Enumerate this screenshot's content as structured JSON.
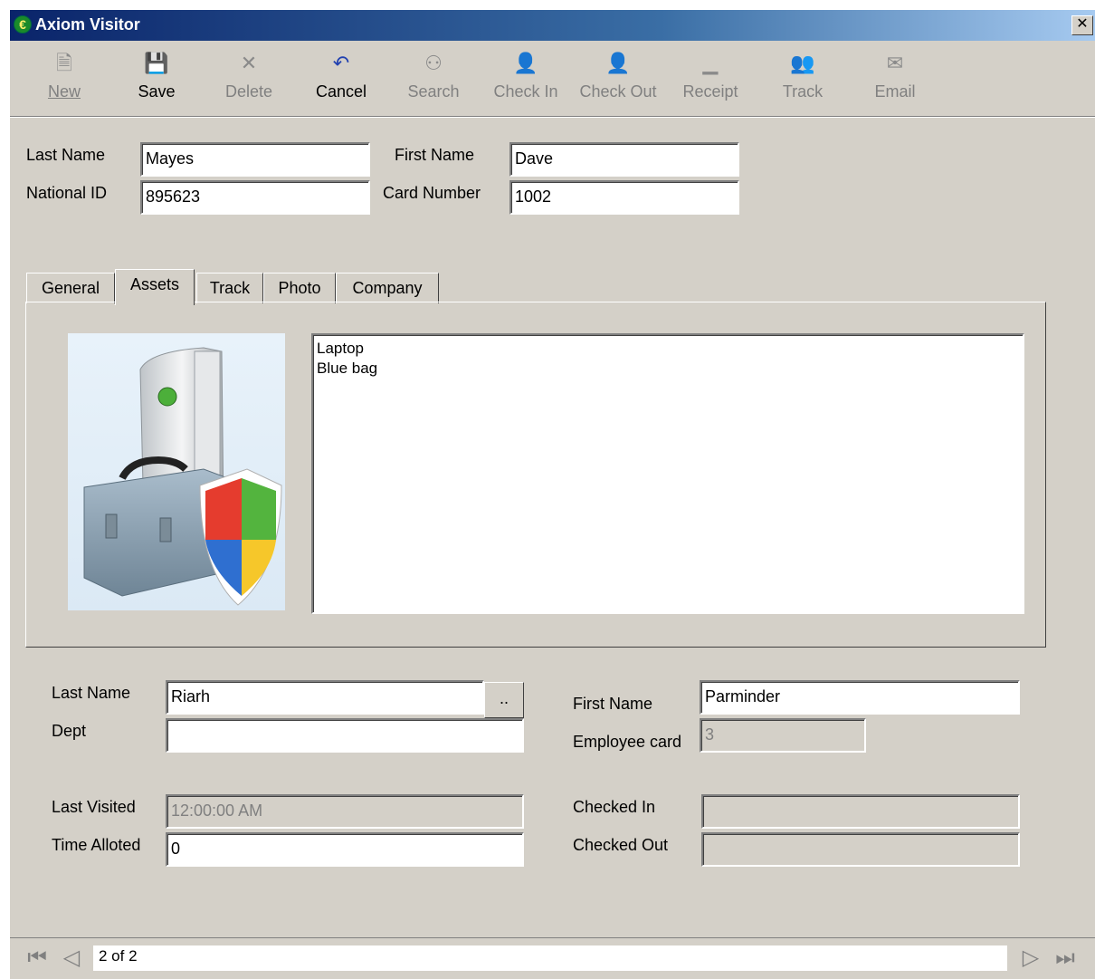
{
  "window": {
    "title": "Axiom Visitor",
    "close_glyph": "✕"
  },
  "toolbar": {
    "new": "New",
    "save": "Save",
    "delete": "Delete",
    "cancel": "Cancel",
    "search": "Search",
    "check_in": "Check In",
    "check_out": "Check Out",
    "receipt": "Receipt",
    "track": "Track",
    "email": "Email"
  },
  "visitor": {
    "last_name_label": "Last Name",
    "last_name": "Mayes",
    "first_name_label": "First Name",
    "first_name": "Dave",
    "national_id_label": "National ID",
    "national_id": "895623",
    "card_number_label": "Card Number",
    "card_number": "1002"
  },
  "tabs": [
    "General",
    "Assets",
    "Track",
    "Photo",
    "Company"
  ],
  "assets": {
    "lines": [
      "Laptop",
      "Blue bag"
    ]
  },
  "host": {
    "last_name_label": "Last Name",
    "last_name": "Riarh",
    "browse_label": "..",
    "first_name_label": "First Name",
    "first_name": "Parminder",
    "dept_label": "Dept",
    "dept": "",
    "employee_card_label": "Employee card",
    "employee_card": "3"
  },
  "visit": {
    "last_visited_label": "Last Visited",
    "last_visited": "12:00:00 AM",
    "time_alloted_label": "Time Alloted",
    "time_alloted": "0",
    "checked_in_label": "Checked In",
    "checked_in": "",
    "checked_out_label": "Checked Out",
    "checked_out": ""
  },
  "navigator": {
    "record": "2 of 2"
  },
  "icons": {
    "new": "new-document-icon",
    "save": "floppy-disk-icon",
    "delete": "x-delete-icon",
    "cancel": "undo-arrow-icon",
    "search": "binoculars-icon",
    "check_in": "person-plus-icon",
    "check_out": "person-minus-icon",
    "receipt": "receipt-icon",
    "track": "people-icon",
    "email": "email-icon"
  }
}
